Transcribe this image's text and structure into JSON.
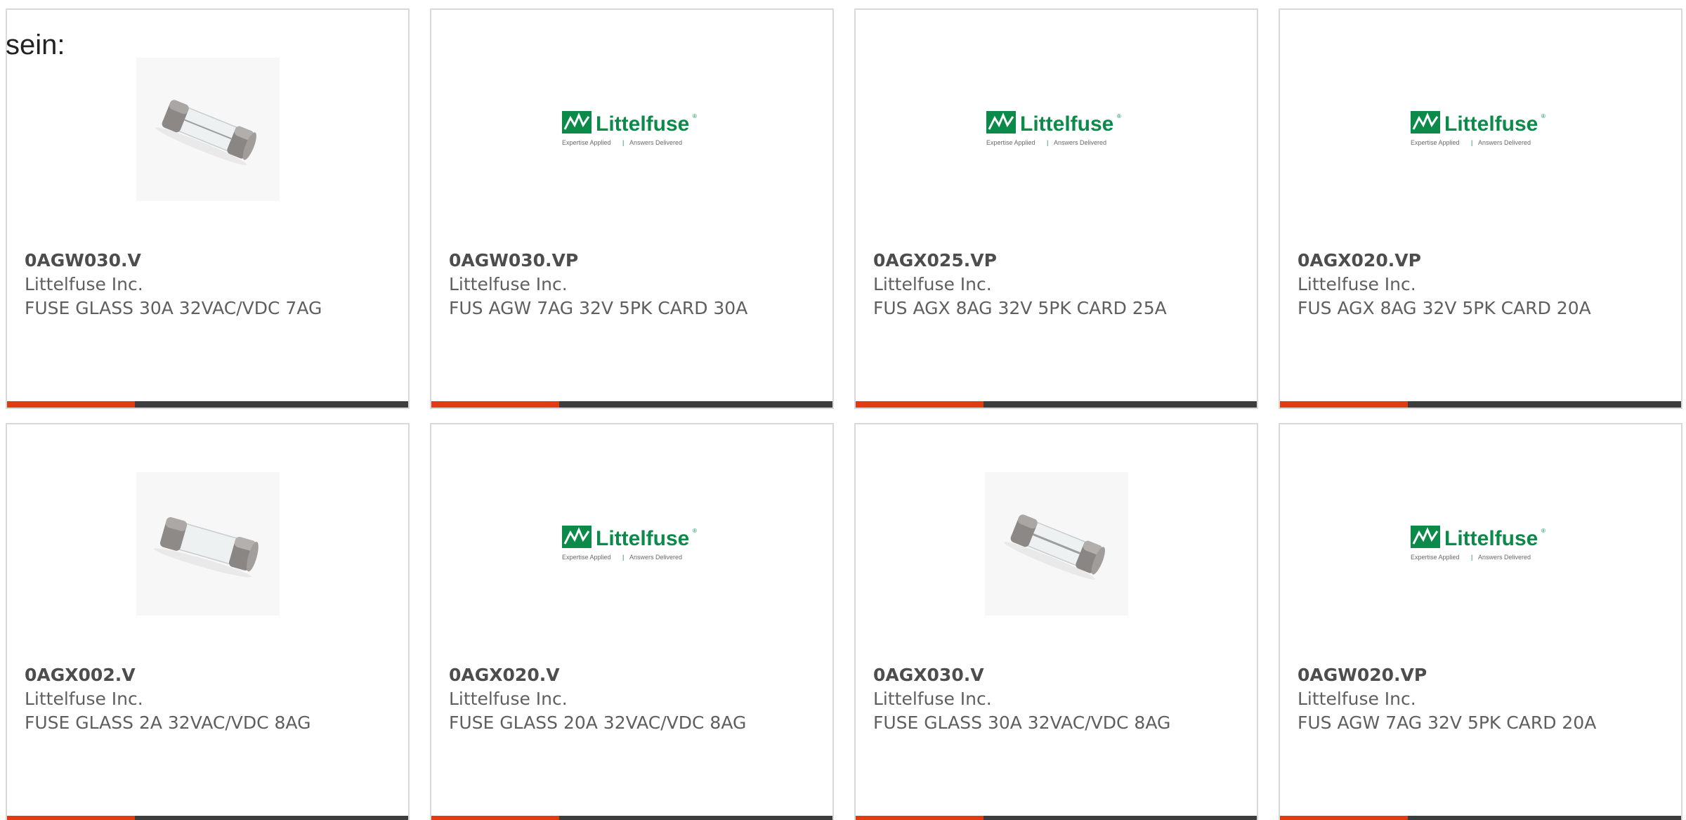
{
  "intro_text": "sein:",
  "colors": {
    "card_border": "#d9d9d9",
    "bar_dark": "#3d3d3d",
    "bar_accent": "#e23a12",
    "brand_green": "#0b8a4a"
  },
  "logo": {
    "brand": "Littelfuse",
    "trademark": "®",
    "tagline_left": "Expertise Applied",
    "tagline_sep": "|",
    "tagline_right": "Answers Delivered"
  },
  "products": [
    {
      "image": "glass-fuse-photo",
      "part": "0AGW030.V",
      "manufacturer": "Littelfuse Inc.",
      "description": "FUSE GLASS 30A 32VAC/VDC 7AG"
    },
    {
      "image": "littelfuse-logo",
      "part": "0AGW030.VP",
      "manufacturer": "Littelfuse Inc.",
      "description": "FUS AGW 7AG 32V 5PK CARD 30A"
    },
    {
      "image": "littelfuse-logo",
      "part": "0AGX025.VP",
      "manufacturer": "Littelfuse Inc.",
      "description": "FUS AGX 8AG 32V 5PK CARD 25A"
    },
    {
      "image": "littelfuse-logo",
      "part": "0AGX020.VP",
      "manufacturer": "Littelfuse Inc.",
      "description": "FUS AGX 8AG 32V 5PK CARD 20A"
    },
    {
      "image": "glass-fuse-photo",
      "part": "0AGX002.V",
      "manufacturer": "Littelfuse Inc.",
      "description": "FUSE GLASS 2A 32VAC/VDC 8AG"
    },
    {
      "image": "littelfuse-logo",
      "part": "0AGX020.V",
      "manufacturer": "Littelfuse Inc.",
      "description": "FUSE GLASS 20A 32VAC/VDC 8AG"
    },
    {
      "image": "glass-fuse-photo",
      "part": "0AGX030.V",
      "manufacturer": "Littelfuse Inc.",
      "description": "FUSE GLASS 30A 32VAC/VDC 8AG"
    },
    {
      "image": "littelfuse-logo",
      "part": "0AGW020.VP",
      "manufacturer": "Littelfuse Inc.",
      "description": "FUS AGW 7AG 32V 5PK CARD 20A"
    }
  ]
}
